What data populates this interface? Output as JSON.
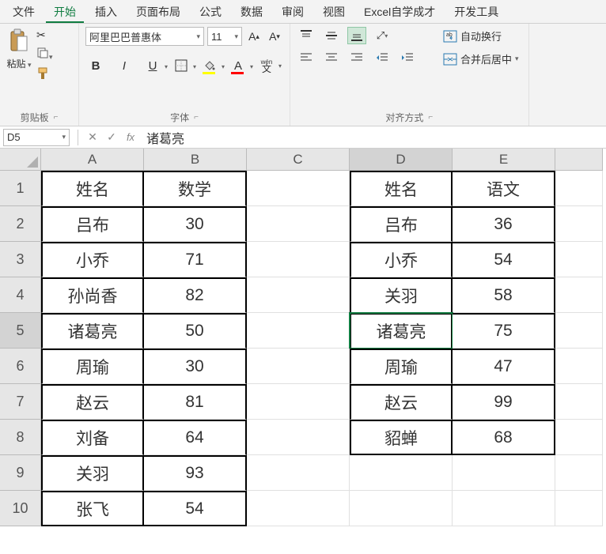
{
  "menu": {
    "file": "文件",
    "home": "开始",
    "insert": "插入",
    "page_layout": "页面布局",
    "formulas": "公式",
    "data": "数据",
    "review": "审阅",
    "view": "视图",
    "custom": "Excel自学成才",
    "developer": "开发工具"
  },
  "ribbon": {
    "clipboard": {
      "paste": "粘贴",
      "label": "剪贴板"
    },
    "font": {
      "name": "阿里巴巴普惠体",
      "size": "11",
      "bold": "B",
      "italic": "I",
      "underline": "U",
      "ruby": "wén",
      "ruby_sub": "文",
      "label": "字体"
    },
    "align": {
      "wrap": "自动换行",
      "merge": "合并后居中",
      "label": "对齐方式"
    }
  },
  "formula_bar": {
    "cell_ref": "D5",
    "value": "诸葛亮"
  },
  "columns": [
    "A",
    "B",
    "C",
    "D",
    "E"
  ],
  "rows": [
    "1",
    "2",
    "3",
    "4",
    "5",
    "6",
    "7",
    "8",
    "9",
    "10"
  ],
  "active_cell": {
    "row": 5,
    "col": "D"
  },
  "chart_data": {
    "type": "table",
    "tables": [
      {
        "range": "A1:B10",
        "headers": [
          "姓名",
          "数学"
        ],
        "rows": [
          [
            "吕布",
            30
          ],
          [
            "小乔",
            71
          ],
          [
            "孙尚香",
            82
          ],
          [
            "诸葛亮",
            50
          ],
          [
            "周瑜",
            30
          ],
          [
            "赵云",
            81
          ],
          [
            "刘备",
            64
          ],
          [
            "关羽",
            93
          ],
          [
            "张飞",
            54
          ]
        ]
      },
      {
        "range": "D1:E8",
        "headers": [
          "姓名",
          "语文"
        ],
        "rows": [
          [
            "吕布",
            36
          ],
          [
            "小乔",
            54
          ],
          [
            "关羽",
            58
          ],
          [
            "诸葛亮",
            75
          ],
          [
            "周瑜",
            47
          ],
          [
            "赵云",
            99
          ],
          [
            "貂蝉",
            68
          ]
        ]
      }
    ]
  },
  "cells": {
    "A1": "姓名",
    "B1": "数学",
    "D1": "姓名",
    "E1": "语文",
    "A2": "吕布",
    "B2": "30",
    "D2": "吕布",
    "E2": "36",
    "A3": "小乔",
    "B3": "71",
    "D3": "小乔",
    "E3": "54",
    "A4": "孙尚香",
    "B4": "82",
    "D4": "关羽",
    "E4": "58",
    "A5": "诸葛亮",
    "B5": "50",
    "D5": "诸葛亮",
    "E5": "75",
    "A6": "周瑜",
    "B6": "30",
    "D6": "周瑜",
    "E6": "47",
    "A7": "赵云",
    "B7": "81",
    "D7": "赵云",
    "E7": "99",
    "A8": "刘备",
    "B8": "64",
    "D8": "貂蝉",
    "E8": "68",
    "A9": "关羽",
    "B9": "93",
    "A10": "张飞",
    "B10": "54"
  }
}
